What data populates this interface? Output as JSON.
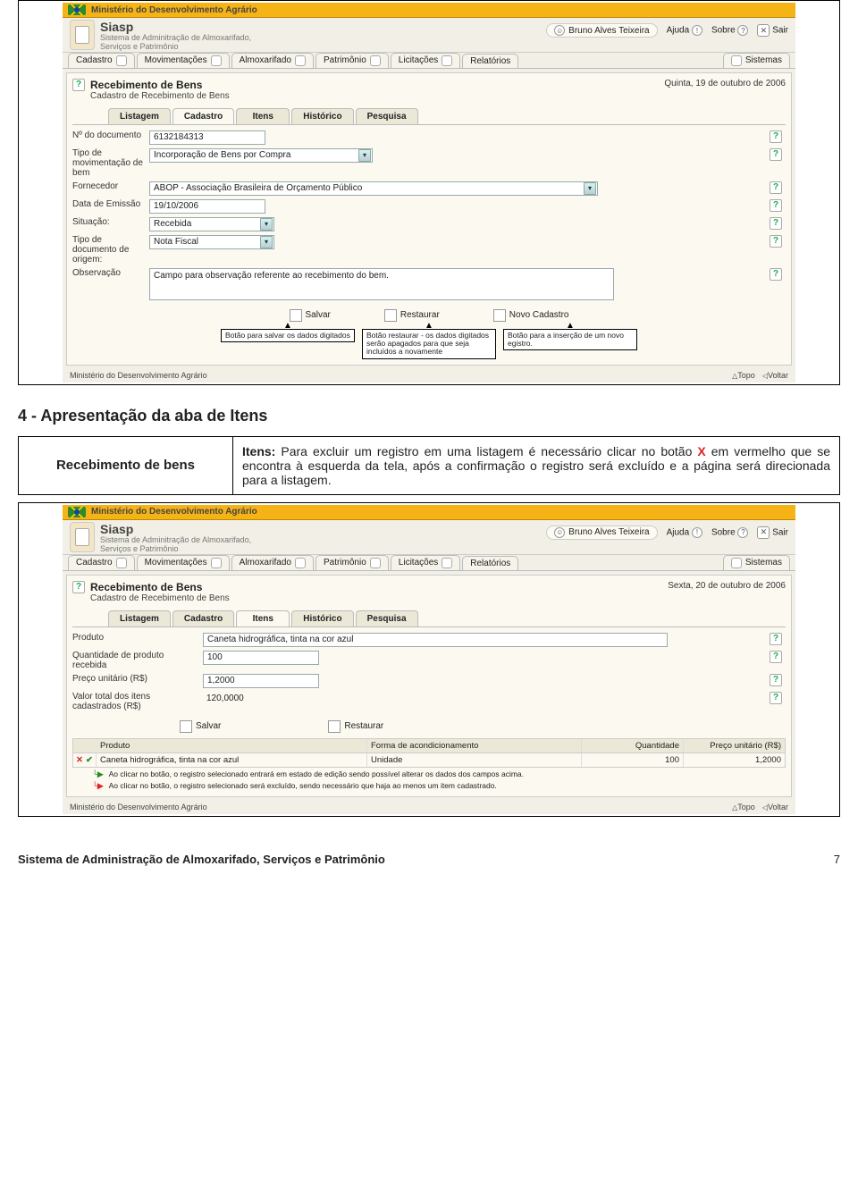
{
  "section1": {
    "ministry": "Ministério do Desenvolvimento Agrário",
    "brand": "Siasp",
    "brand_sub1": "Sistema de Adminitração de Almoxarifado,",
    "brand_sub2": "Serviços e Patrimônio",
    "user": "Bruno Alves Teixeira",
    "help": "Ajuda",
    "about": "Sobre",
    "exit": "Sair",
    "nav": [
      "Cadastro",
      "Movimentações",
      "Almoxarifado",
      "Patrimônio",
      "Licitações",
      "Relatórios",
      "Sistemas"
    ],
    "page_title": "Recebimento de Bens",
    "page_sub": "Cadastro de Recebimento de Bens",
    "date": "Quinta, 19 de outubro de 2006",
    "tabs": [
      "Listagem",
      "Cadastro",
      "Itens",
      "Histórico",
      "Pesquisa"
    ],
    "active_tab": "Cadastro",
    "fields": {
      "num": {
        "label": "Nº do documento",
        "value": "6132184313"
      },
      "tipo_mov": {
        "label": "Tipo de movimentação de bem",
        "value": "Incorporação de Bens por Compra"
      },
      "forn": {
        "label": "Fornecedor",
        "value": "ABOP - Associação Brasileira de Orçamento Público"
      },
      "data": {
        "label": "Data de Emissão",
        "value": "19/10/2006"
      },
      "sit": {
        "label": "Situação:",
        "value": "Recebida"
      },
      "tipo_doc": {
        "label": "Tipo de documento de origem:",
        "value": "Nota Fiscal"
      },
      "obs": {
        "label": "Observação",
        "value": "Campo para observação referente ao recebimento do bem."
      }
    },
    "actions": {
      "save": "Salvar",
      "restore": "Restaurar",
      "new": "Novo Cadastro"
    },
    "callouts": {
      "save": "Botão para salvar os dados digitados",
      "restore": "Botão restaurar - os dados digitados serão apagados para que seja incluídos a novamente",
      "new": "Botão para a inserção de um novo egistro."
    },
    "footer_left": "Ministério do Desenvolvimento Agrário",
    "footer_top": "Topo",
    "footer_back": "Voltar"
  },
  "doc": {
    "heading": "4 - Apresentação da aba de Itens",
    "left": "Recebimento de bens",
    "right_html": "Itens: Para excluir um registro em uma listagem é necessário clicar no botão X em vermelho que se encontra à esquerda da tela, após a confirmação o registro será excluído e a página será direcionada para a listagem.",
    "footer": "Sistema de Administração de Almoxarifado, Serviços e Patrimônio",
    "page": "7"
  },
  "section2": {
    "date": "Sexta, 20 de outubro de 2006",
    "active_tab": "Itens",
    "fields": {
      "prod": {
        "label": "Produto",
        "value": "Caneta hidrográfica, tinta na cor azul"
      },
      "qtd": {
        "label": "Quantidade de produto recebida",
        "value": "100"
      },
      "preco": {
        "label": "Preço unitário (R$)",
        "value": "1,2000"
      },
      "total": {
        "label": "Valor total dos itens cadastrados (R$)",
        "value": "120,0000"
      }
    },
    "actions": {
      "save": "Salvar",
      "restore": "Restaurar"
    },
    "table": {
      "headers": [
        "Produto",
        "Forma de acondicionamento",
        "Quantidade",
        "Preço unitário (R$)"
      ],
      "row": {
        "produto": "Caneta hidrográfica, tinta na cor azul",
        "forma": "Unidade",
        "qtd": "100",
        "preco": "1,2000"
      }
    },
    "note_green": "Ao clicar no botão, o registro selecionado entrará em estado de edição sendo possível alterar os dados dos campos acima.",
    "note_red": "Ao clicar no botão, o registro selecionado será excluído, sendo necessário que haja ao menos um item cadastrado."
  }
}
